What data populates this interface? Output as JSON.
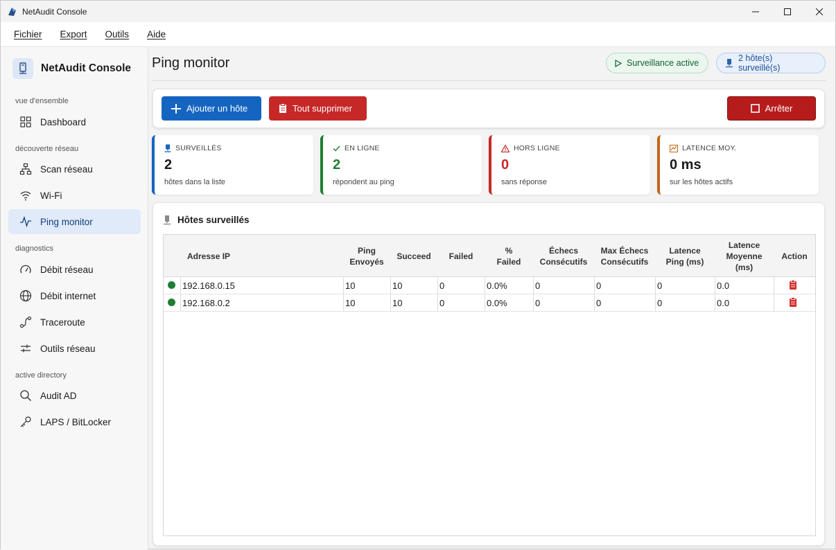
{
  "window": {
    "title": "NetAudit Console"
  },
  "menu": [
    "Fichier",
    "Export",
    "Outils",
    "Aide"
  ],
  "sidebar": {
    "brand": "NetAudit Console",
    "sections": {
      "overview": "vue d'ensemble",
      "discovery": "découverte réseau",
      "diagnostics": "diagnostics",
      "ad": "active directory"
    },
    "items": {
      "dashboard": "Dashboard",
      "scan": "Scan réseau",
      "wifi": "Wi-Fi",
      "ping": "Ping monitor",
      "debit_reseau": "Débit réseau",
      "debit_internet": "Débit internet",
      "traceroute": "Traceroute",
      "outils": "Outils réseau",
      "audit_ad": "Audit AD",
      "laps": "LAPS / BitLocker"
    },
    "active": "ping"
  },
  "page": {
    "title": "Ping monitor",
    "status_pill": "Surveillance active",
    "hosts_pill": "2 hôte(s) surveillé(s)"
  },
  "toolbar": {
    "add_label": "Ajouter un hôte",
    "delete_all_label": "Tout supprimer",
    "stop_label": "Arrêter"
  },
  "stats": {
    "monitored": {
      "label": "SURVEILLÉS",
      "value": "2",
      "sub": "hôtes dans la liste",
      "color": "#1565c0"
    },
    "online": {
      "label": "EN LIGNE",
      "value": "2",
      "sub": "répondent au ping",
      "color": "#1e7e34"
    },
    "offline": {
      "label": "HORS LIGNE",
      "value": "0",
      "sub": "sans réponse",
      "color": "#c62828"
    },
    "latency": {
      "label": "LATENCE MOY.",
      "value": "0 ms",
      "sub": "sur les hôtes actifs",
      "color": "#c0661a"
    }
  },
  "hosts": {
    "title": "Hôtes surveillés",
    "columns": {
      "ip": "Adresse IP",
      "sent_1": "Ping",
      "sent_2": "Envoyés",
      "succeed": "Succeed",
      "failed": "Failed",
      "pct_1": "%",
      "pct_2": "Failed",
      "consec_1": "Échecs",
      "consec_2": "Consécutifs",
      "maxconsec_1": "Max Échecs",
      "maxconsec_2": "Consécutifs",
      "lat_1": "Latence",
      "lat_2": "Ping (ms)",
      "avg_1": "Latence",
      "avg_2": "Moyenne",
      "avg_3": "(ms)",
      "action": "Action"
    },
    "rows": [
      {
        "ip": "192.168.0.15",
        "sent": "10",
        "succeed": "10",
        "failed": "0",
        "pct": "0.0%",
        "consec": "0",
        "maxconsec": "0",
        "lat": "0",
        "avg": "0.0",
        "status": "online"
      },
      {
        "ip": "192.168.0.2",
        "sent": "10",
        "succeed": "10",
        "failed": "0",
        "pct": "0.0%",
        "consec": "0",
        "maxconsec": "0",
        "lat": "0",
        "avg": "0.0",
        "status": "online"
      }
    ]
  }
}
